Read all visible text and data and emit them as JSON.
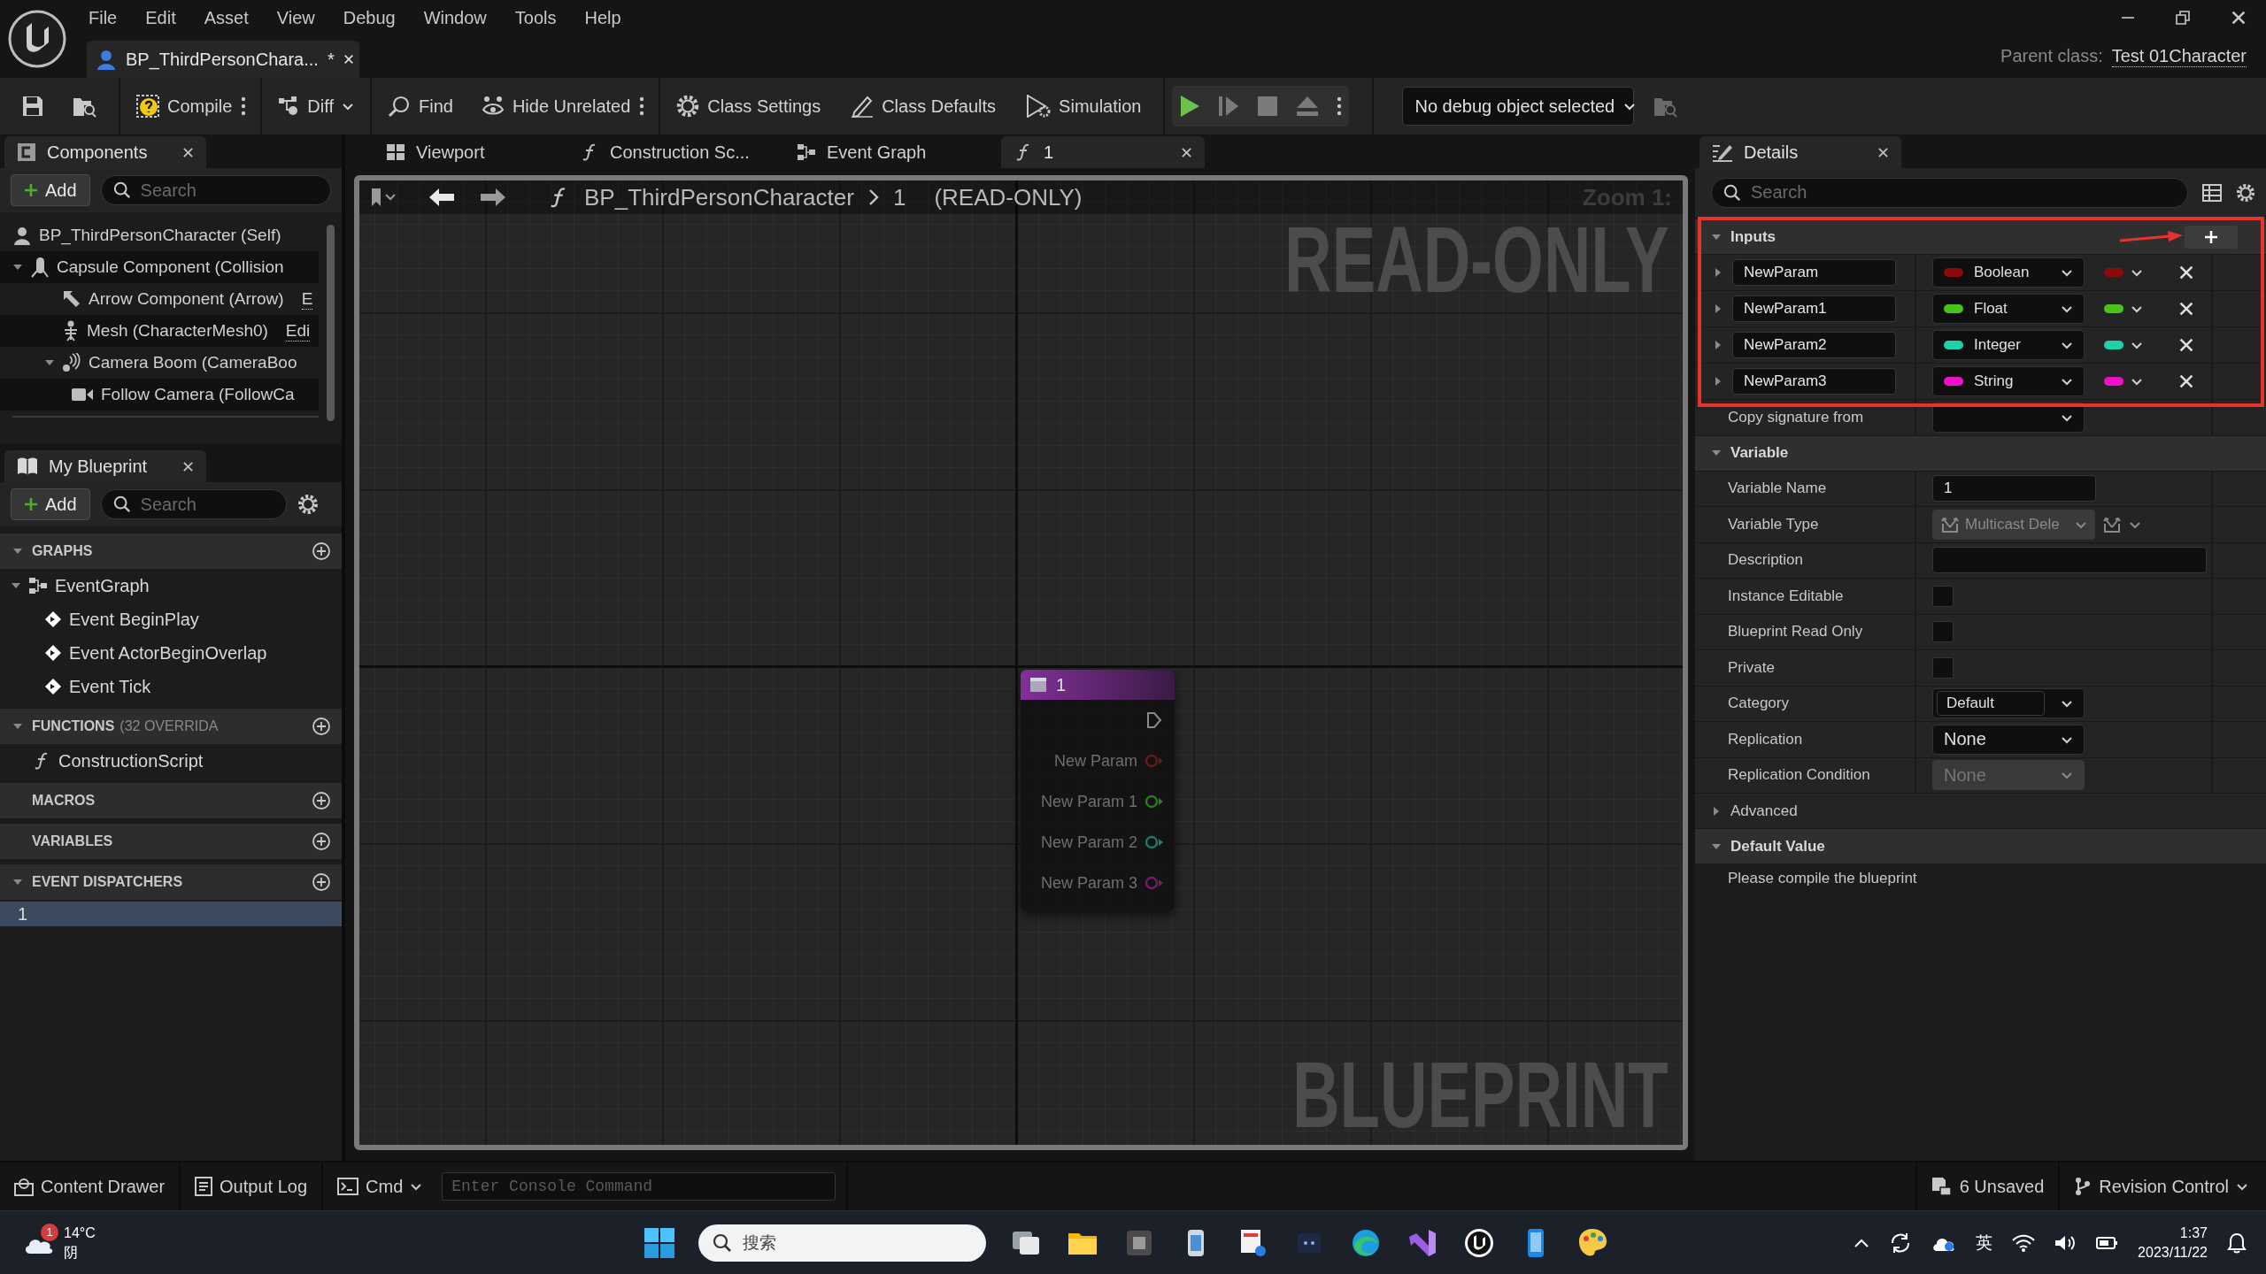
{
  "title_bar": {
    "menu": [
      "File",
      "Edit",
      "Asset",
      "View",
      "Debug",
      "Window",
      "Tools",
      "Help"
    ],
    "document_tab": {
      "title": "BP_ThirdPersonChara...",
      "modified": "*"
    },
    "parent_class": {
      "label": "Parent class:",
      "value": "Test 01Character"
    }
  },
  "toolbar": {
    "buttons": [
      {
        "label": "Compile"
      },
      {
        "label": "Diff"
      },
      {
        "label": "Find"
      },
      {
        "label": "Hide Unrelated"
      },
      {
        "label": "Class Settings"
      },
      {
        "label": "Class Defaults"
      },
      {
        "label": "Simulation"
      }
    ],
    "debug_object": "No debug object selected"
  },
  "components_panel": {
    "tab": "Components",
    "add_button": "Add",
    "search": {
      "placeholder": "Search"
    },
    "tree": [
      {
        "label": "BP_ThirdPersonCharacter (Self)",
        "children": [
          {
            "label": "Capsule Component (Collision",
            "expanded": true,
            "children": [
              {
                "label": "Arrow Component (Arrow)",
                "edit_link": "E"
              },
              {
                "label": "Mesh (CharacterMesh0)",
                "edit_link": "Edi"
              },
              {
                "label": "Camera Boom (CameraBoo",
                "expanded": true,
                "children": [
                  {
                    "label": "Follow Camera (FollowCa"
                  }
                ]
              }
            ]
          }
        ]
      }
    ]
  },
  "my_blueprint_panel": {
    "tab": "My Blueprint",
    "add_button": "Add",
    "search": {
      "placeholder": "Search"
    },
    "sections": [
      {
        "title": "GRAPHS",
        "expanded": true,
        "items": [
          {
            "label": "EventGraph",
            "selected": false,
            "expanded": true,
            "children": [
              {
                "label": "Event BeginPlay",
                "selected": false
              },
              {
                "label": "Event ActorBeginOverlap",
                "selected": false
              },
              {
                "label": "Event Tick",
                "selected": false
              }
            ]
          }
        ]
      },
      {
        "title": "FUNCTIONS",
        "note": "(32 OVERRIDA",
        "expanded": true,
        "items": [
          {
            "label": "ConstructionScript",
            "selected": false
          }
        ]
      },
      {
        "title": "MACROS"
      },
      {
        "title": "VARIABLES"
      },
      {
        "title": "EVENT DISPATCHERS",
        "expanded": true,
        "items": [
          {
            "label": "1",
            "selected": true
          }
        ]
      }
    ]
  },
  "graph_editor": {
    "tabs": [
      {
        "label": "Viewport",
        "selected": false
      },
      {
        "label": "Construction Sc...",
        "selected": false
      },
      {
        "label": "Event Graph",
        "selected": false
      },
      {
        "label": "1",
        "selected": true
      }
    ],
    "breadcrumb": [
      "BP_ThirdPersonCharacter",
      "1"
    ],
    "mode": "(READ-ONLY)",
    "zoom": "Zoom 1:",
    "overlay_top": "READ-ONLY",
    "overlay_bottom": "BLUEPRINT",
    "node": {
      "title": "1",
      "pins": [
        {
          "label": "New Param",
          "color": "#6b1818"
        },
        {
          "label": "New Param 1",
          "color": "#2f7a24"
        },
        {
          "label": "New Param 2",
          "color": "#1f7a66"
        },
        {
          "label": "New Param 3",
          "color": "#7a1a6e"
        }
      ]
    }
  },
  "details_panel": {
    "tab": "Details",
    "search": {
      "placeholder": "Search"
    },
    "inputs": {
      "title": "Inputs",
      "expanded": true,
      "params": [
        {
          "name": "NewParam",
          "type": "Boolean",
          "color": "#8b0a0a"
        },
        {
          "name": "NewParam1",
          "type": "Float",
          "color": "#46c41a"
        },
        {
          "name": "NewParam2",
          "type": "Integer",
          "color": "#1fd1a8"
        },
        {
          "name": "NewParam3",
          "type": "String",
          "color": "#f010c8"
        }
      ]
    },
    "copy_signature": {
      "label": "Copy signature from"
    },
    "variable": {
      "title": "Variable",
      "expanded": true,
      "rows": [
        {
          "kind": "text",
          "label": "Variable Name",
          "value": "1"
        },
        {
          "kind": "type",
          "label": "Variable Type",
          "value": "Multicast Dele",
          "disabled": true
        },
        {
          "kind": "wide_text",
          "label": "Description"
        },
        {
          "kind": "check",
          "label": "Instance Editable",
          "checked": false
        },
        {
          "kind": "check",
          "label": "Blueprint Read Only",
          "checked": false
        },
        {
          "kind": "check",
          "label": "Private",
          "checked": false
        },
        {
          "kind": "combo",
          "label": "Category",
          "value": "Default"
        },
        {
          "kind": "select",
          "label": "Replication",
          "value": "None",
          "disabled": false
        },
        {
          "kind": "select",
          "label": "Replication Condition",
          "value": "None",
          "disabled": true
        }
      ]
    },
    "advanced": {
      "title": "Advanced",
      "expanded": false
    },
    "default_value": {
      "title": "Default Value",
      "expanded": true,
      "message": "Please compile the blueprint"
    }
  },
  "status_bar": {
    "content_drawer": "Content Drawer",
    "output_log": "Output Log",
    "cmd": "Cmd",
    "console": {
      "placeholder": "Enter Console Command"
    },
    "unsaved": "6 Unsaved",
    "revision_control": "Revision Control"
  },
  "taskbar": {
    "weather": {
      "temperature": "14°C",
      "condition": "阴",
      "badge": "1"
    },
    "search": {
      "placeholder": "搜索"
    },
    "input_method": "英",
    "time": "1:37",
    "date": "2023/11/22"
  }
}
